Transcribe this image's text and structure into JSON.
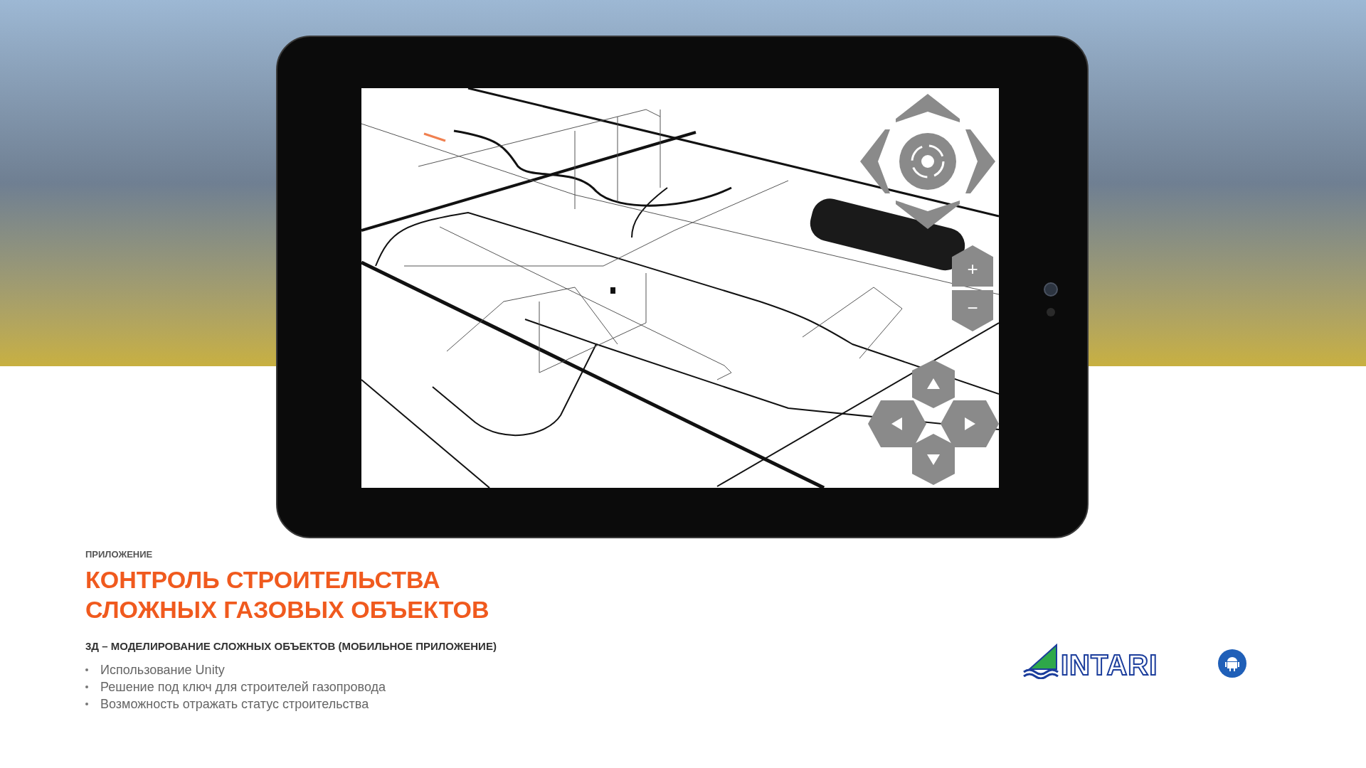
{
  "app_screen": {
    "zoom_controls": [
      {
        "kind": "zoom_in",
        "label": "+"
      },
      {
        "kind": "zoom_out",
        "label": "−"
      }
    ]
  },
  "eyebrow": "ПРИЛОЖЕНИЕ",
  "title_lines": [
    "КОНТРОЛЬ СТРОИТЕЛЬСТВА",
    "СЛОЖНЫХ ГАЗОВЫХ ОБЪЕКТОВ"
  ],
  "subtitle": "3Д – МОДЕЛИРОВАНИЕ СЛОЖНЫХ ОБЪЕКТОВ (МОБИЛЬНОЕ ПРИЛОЖЕНИЕ)",
  "bullets": [
    "Использование Unity",
    "Решение под ключ для строителей газопровода",
    "Возможность отражать статус строительства"
  ],
  "logo": {
    "text": "INTARI"
  }
}
